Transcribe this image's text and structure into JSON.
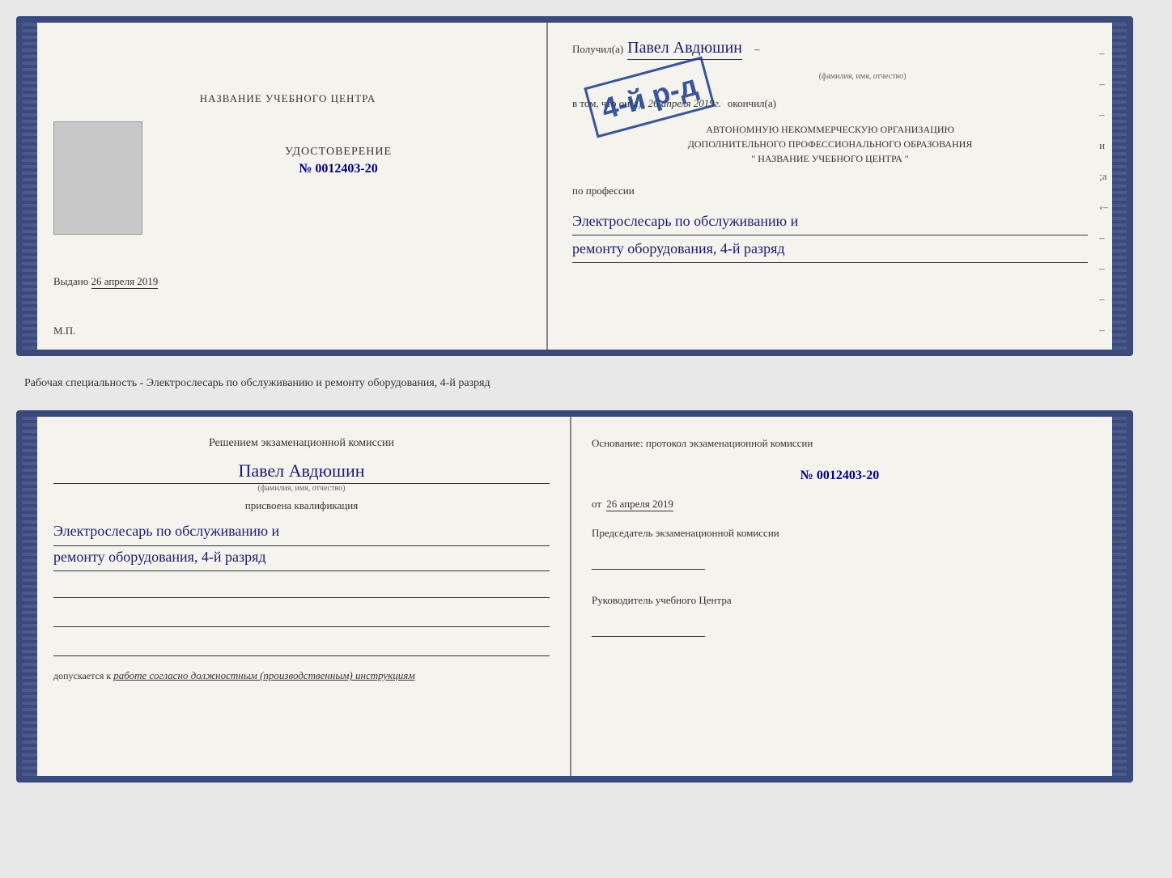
{
  "top_doc": {
    "left": {
      "title": "НАЗВАНИЕ УЧЕБНОГО ЦЕНТРА",
      "cert_label": "УДОСТОВЕРЕНИЕ",
      "cert_number": "№ 0012403-20",
      "issued_prefix": "Выдано",
      "issued_date": "26 апреля 2019",
      "mp": "М.П."
    },
    "right": {
      "recipient_prefix": "Получил(а)",
      "recipient_name": "Павел Авдюшин",
      "fio_label": "(фамилия, имя, отчество)",
      "vtom_prefix": "в том, что он(а)",
      "vtom_date": "26 апреля 2019г.",
      "okonchil": "окончил(а)",
      "org_line1": "АВТОНОМНУЮ НЕКОММЕРЧЕСКУЮ ОРГАНИЗАЦИЮ",
      "org_line2": "ДОПОЛНИТЕЛЬНОГО ПРОФЕССИОНАЛЬНОГО ОБРАЗОВАНИЯ",
      "org_line3": "\" НАЗВАНИЕ УЧЕБНОГО ЦЕНТРА \"",
      "profession_label": "по профессии",
      "profession_line1": "Электрослесарь по обслуживанию и",
      "profession_line2": "ремонту оборудования, 4-й разряд",
      "stamp_main": "4-й р-д",
      "stamp_sub": ""
    }
  },
  "separator": {
    "text": "Рабочая специальность - Электрослесарь по обслуживанию и ремонту оборудования, 4-й разряд"
  },
  "bottom_doc": {
    "left": {
      "decision_title": "Решением экзаменационной комиссии",
      "person_name": "Павел Авдюшин",
      "fio_label": "(фамилия, имя, отчество)",
      "assigned_label": "присвоена квалификация",
      "qual_line1": "Электрослесарь по обслуживанию и",
      "qual_line2": "ремонту оборудования, 4-й разряд",
      "admits_prefix": "допускается к",
      "admits_text": "работе согласно должностным (производственным) инструкциям"
    },
    "right": {
      "basis_label": "Основание: протокол экзаменационной комиссии",
      "protocol_number": "№ 0012403-20",
      "from_prefix": "от",
      "from_date": "26 апреля 2019",
      "chairman_label": "Председатель экзаменационной комиссии",
      "head_label": "Руководитель учебного Центра"
    },
    "right_marks": [
      "–",
      "–",
      "–",
      "и",
      ";а",
      "‹–",
      "–",
      "–",
      "–",
      "–"
    ]
  }
}
